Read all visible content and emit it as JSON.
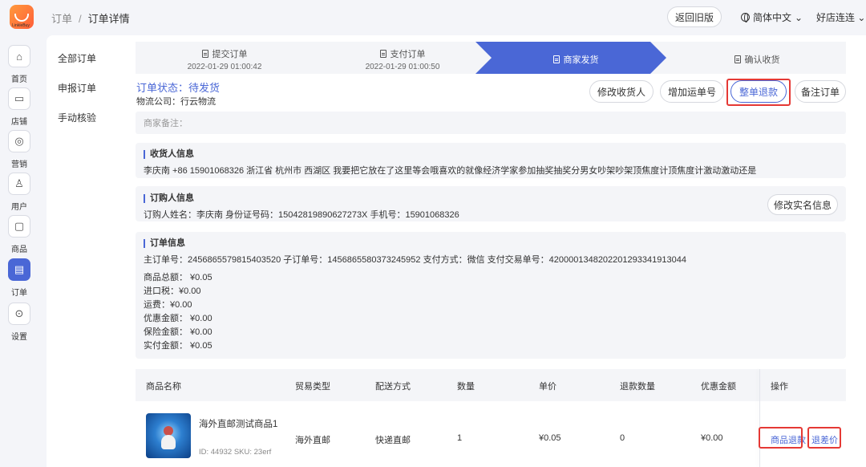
{
  "app": {
    "logo_text": "LinkleBuy"
  },
  "rail": [
    {
      "label": "首页",
      "icon": "home-icon",
      "glyph": "⌂"
    },
    {
      "label": "店铺",
      "icon": "store-icon",
      "glyph": "▭"
    },
    {
      "label": "营销",
      "icon": "marketing-icon",
      "glyph": "◎"
    },
    {
      "label": "用户",
      "icon": "user-icon",
      "glyph": "♙"
    },
    {
      "label": "商品",
      "icon": "product-icon",
      "glyph": "▢"
    },
    {
      "label": "订单",
      "icon": "order-icon",
      "glyph": "▤"
    },
    {
      "label": "设置",
      "icon": "settings-icon",
      "glyph": "⊙"
    }
  ],
  "topbar": {
    "crumb_root": "订单",
    "crumb_sep": "/",
    "crumb_current": "订单详情",
    "back_label": "返回旧版",
    "lang_label": "简体中文",
    "lang_caret": "⌄",
    "shop_name": "好店连连",
    "shop_caret": "⌄"
  },
  "subnav": [
    "全部订单",
    "申报订单",
    "手动核验"
  ],
  "steps": [
    {
      "title": "提交订单",
      "date": "2022-01-29 01:00:42"
    },
    {
      "title": "支付订单",
      "date": "2022-01-29 01:00:50"
    },
    {
      "title": "商家发货",
      "date": ""
    },
    {
      "title": "确认收货",
      "date": ""
    }
  ],
  "order": {
    "status_label": "订单状态：",
    "status_value": "待发货",
    "logistics": "物流公司：行云物流",
    "merchant_note_label": "商家备注："
  },
  "actions": {
    "edit_receiver": "修改收货人",
    "add_tracking": "增加运单号",
    "full_refund": "整单退款",
    "note_order": "备注订单"
  },
  "receiver": {
    "title": "收货人信息",
    "line": "李庆南  +86  15901068326  浙江省  杭州市  西湖区  我要把它放在了这里等会哦喜欢的就像经济学家参加抽奖抽奖分男女吵架吵架顶焦度计顶焦度计激动激动还是"
  },
  "buyer": {
    "title": "订购人信息",
    "line": "订购人姓名：李庆南  身份证号码：15042819890627273X  手机号：15901068326",
    "edit_label": "修改实名信息"
  },
  "order_info": {
    "title": "订单信息",
    "line": "主订单号：2456865579815403520  子订单号：1456865580373245952  支付方式：微信  支付交易单号：4200001348202201293341913044",
    "amounts": [
      "商品总额：  ¥0.05",
      "进口税：¥0.00",
      "运费：¥0.00",
      "优惠金额：  ¥0.00",
      "保险金额：  ¥0.00",
      "实付金额：  ¥0.05"
    ]
  },
  "table": {
    "headers": [
      "商品名称",
      "贸易类型",
      "配送方式",
      "数量",
      "单价",
      "退款数量",
      "优惠金额",
      "操作"
    ],
    "row": {
      "name": "海外直邮测试商品1",
      "meta": "ID: 44932  SKU: 23erf",
      "trade": "海外直邮",
      "delivery": "快递直邮",
      "qty": "1",
      "price": "¥0.05",
      "refund_qty": "0",
      "discount": "¥0.00",
      "op_refund": "商品退款",
      "op_diff": "退差价"
    }
  },
  "colors": {
    "accent": "#4a67d6",
    "highlight_box": "#e53935",
    "panel_bg": "#f4f5f8"
  }
}
